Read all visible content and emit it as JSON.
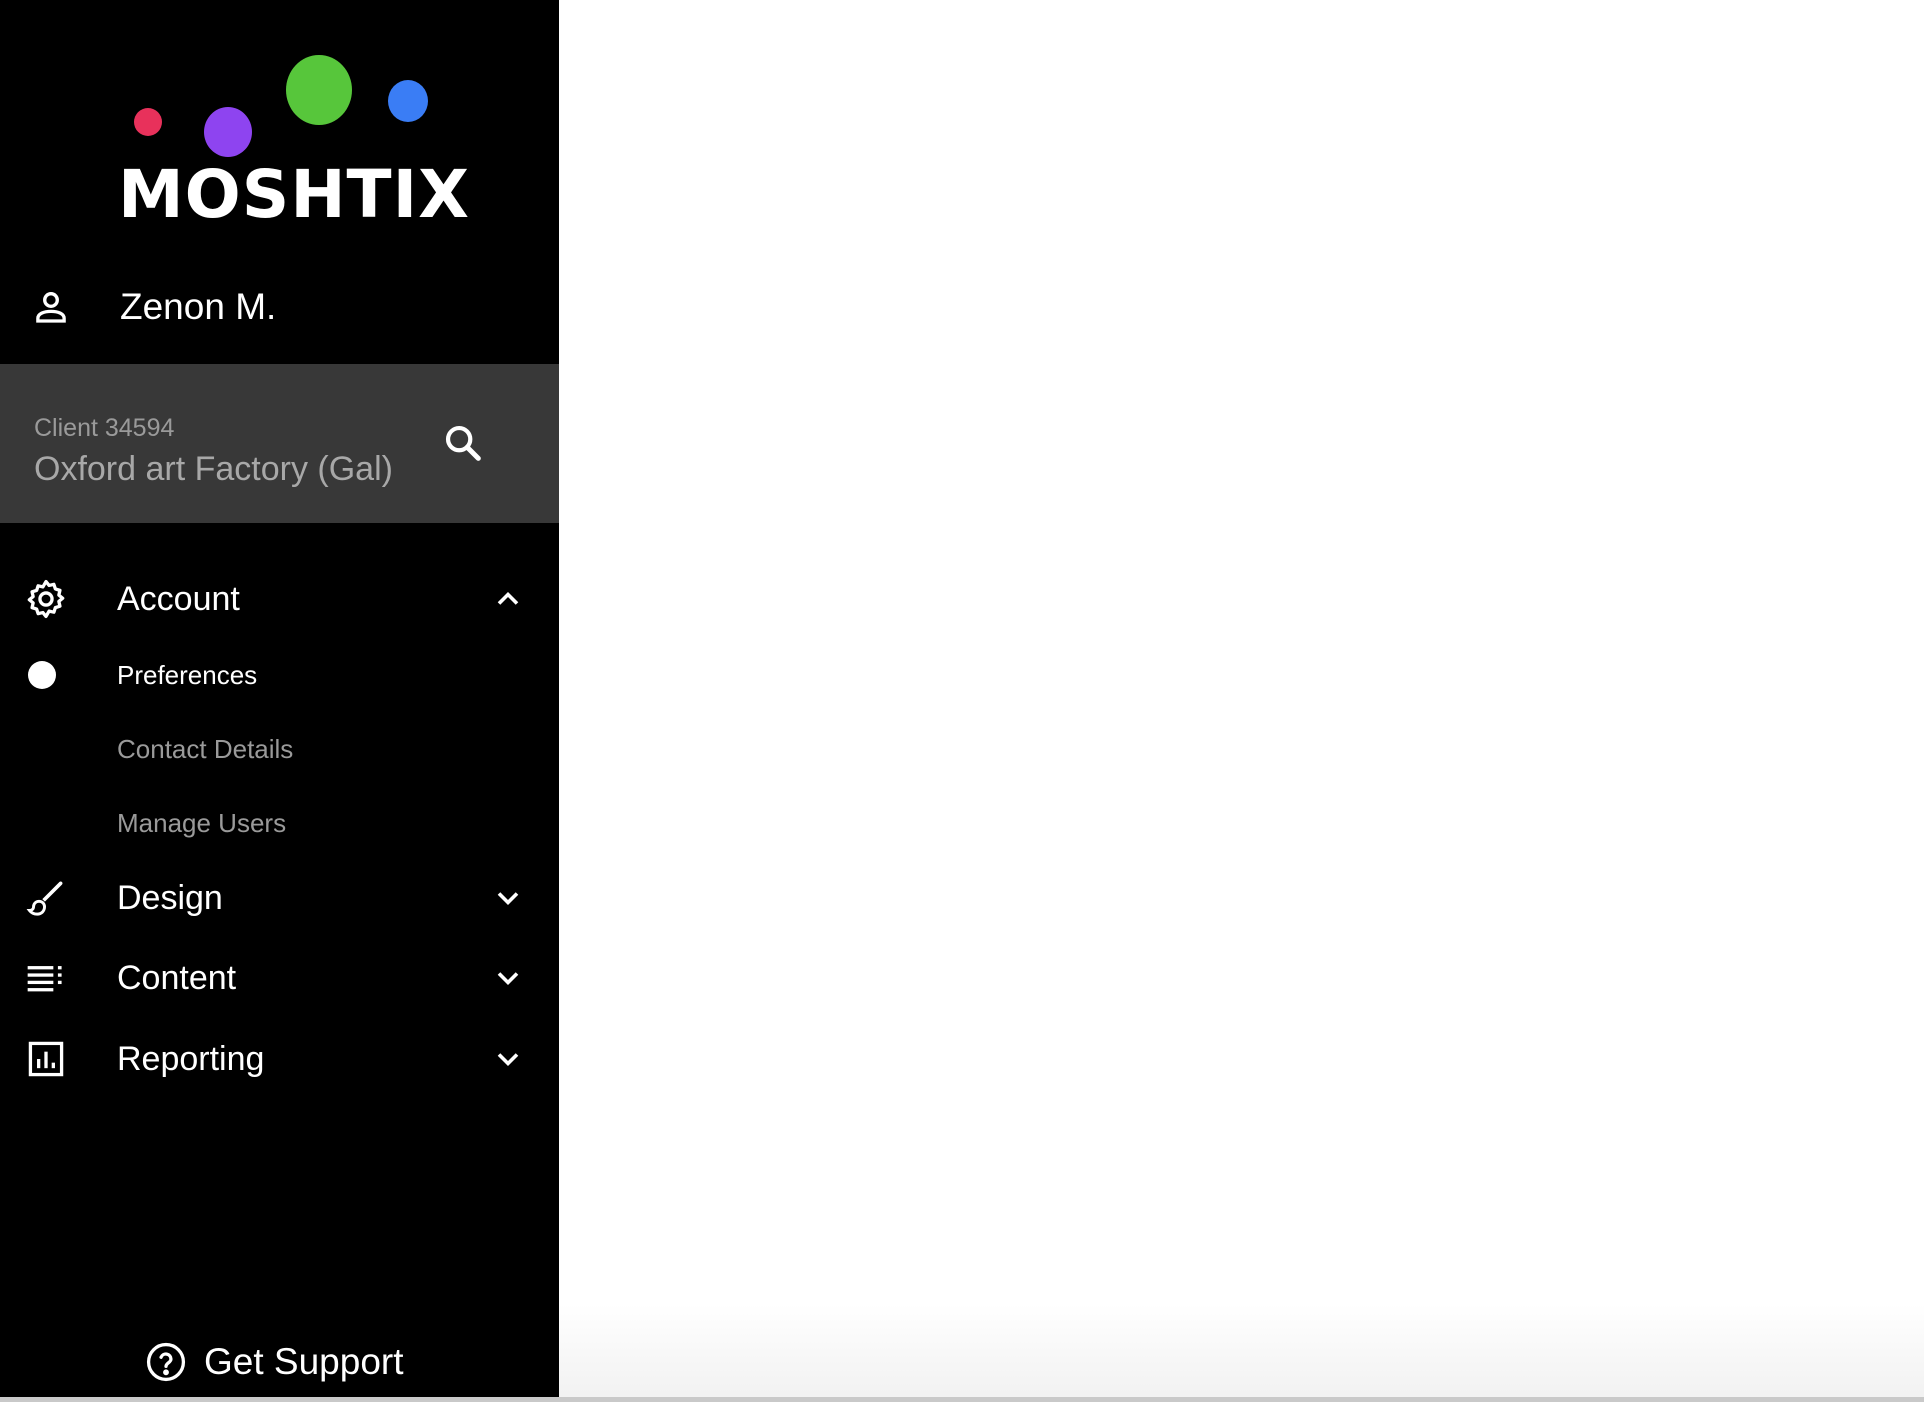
{
  "brand": {
    "name": "MOSHTIX",
    "dot_colors": [
      "#e8315b",
      "#8e44f0",
      "#57c63b",
      "#3a7df5"
    ]
  },
  "user": {
    "name": "Zenon M.",
    "icon": "person-icon"
  },
  "client": {
    "id_label": "Client 34594",
    "name": "Oxford art Factory (Gal)",
    "search_icon": "search-icon"
  },
  "nav": {
    "account": {
      "label": "Account",
      "icon": "gear-icon",
      "expanded": true
    },
    "account_items": [
      {
        "label": "Preferences",
        "active": true
      },
      {
        "label": "Contact Details",
        "active": false
      },
      {
        "label": "Manage Users",
        "active": false
      }
    ],
    "design": {
      "label": "Design",
      "icon": "paintbrush-icon",
      "expanded": false
    },
    "content": {
      "label": "Content",
      "icon": "list-icon",
      "expanded": false
    },
    "reporting": {
      "label": "Reporting",
      "icon": "bar-chart-icon",
      "expanded": false
    }
  },
  "support": {
    "label": "Get Support",
    "icon": "help-circle-icon"
  },
  "colors": {
    "sidebar_bg": "#000000",
    "client_box_bg": "#383838",
    "muted_text": "#9a9a9a",
    "main_bg": "#ffffff"
  }
}
